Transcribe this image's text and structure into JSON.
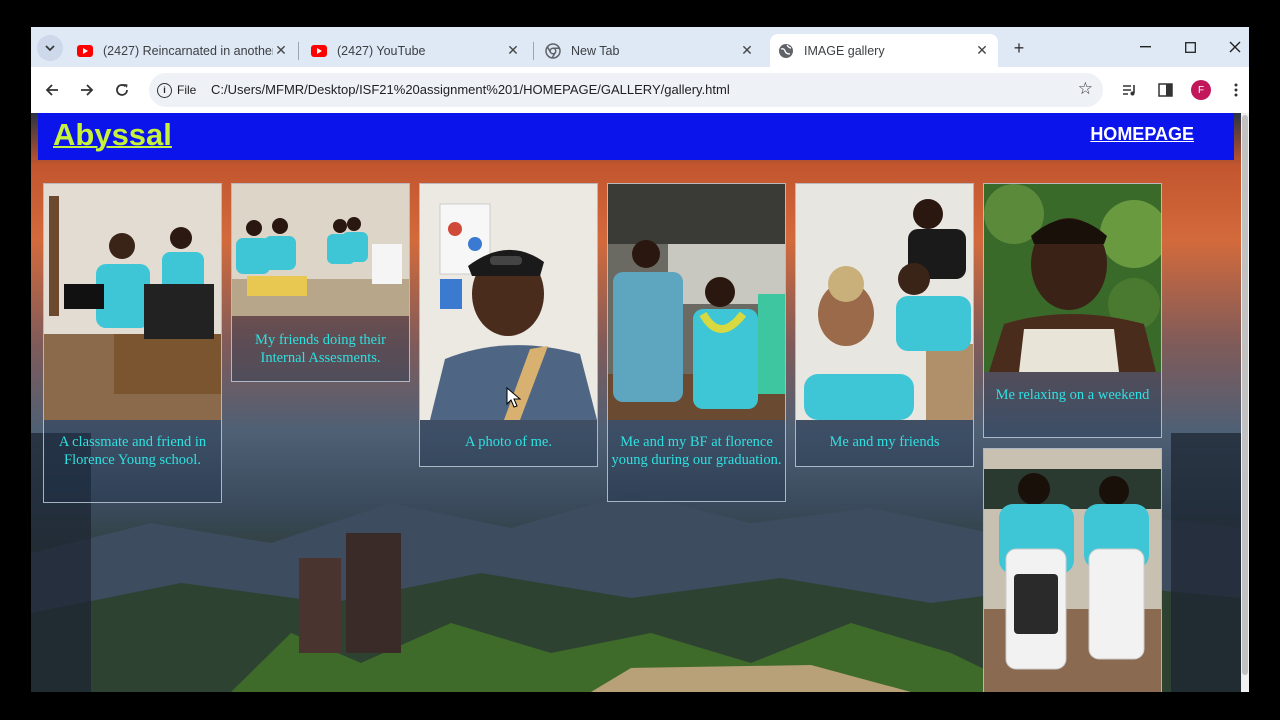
{
  "browser": {
    "tabs": [
      {
        "title": "(2427) Reincarnated in another",
        "favicon": "youtube-icon"
      },
      {
        "title": "(2427) YouTube",
        "favicon": "youtube-icon"
      },
      {
        "title": "New Tab",
        "favicon": "chrome-icon"
      },
      {
        "title": "IMAGE gallery",
        "favicon": "globe-icon",
        "active": true
      }
    ],
    "omnibox": {
      "scheme_label": "File",
      "url": "C:/Users/MFMR/Desktop/ISF21%20assignment%201/HOMEPAGE/GALLERY/gallery.html"
    },
    "profile_initial": "F"
  },
  "site": {
    "logo": "Abyssal",
    "nav_link": "HOMEPAGE",
    "accent": "#0c14ec",
    "logo_color": "#c7f23a",
    "caption_color": "#2fe0e0"
  },
  "gallery": [
    {
      "caption": "A classmate and friend in Florence Young school."
    },
    {
      "caption": "My friends doing their Internal Assesments."
    },
    {
      "caption": "A photo of me."
    },
    {
      "caption": "Me and my BF at florence young during our graduation."
    },
    {
      "caption": "Me and my friends"
    },
    {
      "caption": "Me relaxing on a weekend"
    },
    {
      "caption": ""
    }
  ]
}
